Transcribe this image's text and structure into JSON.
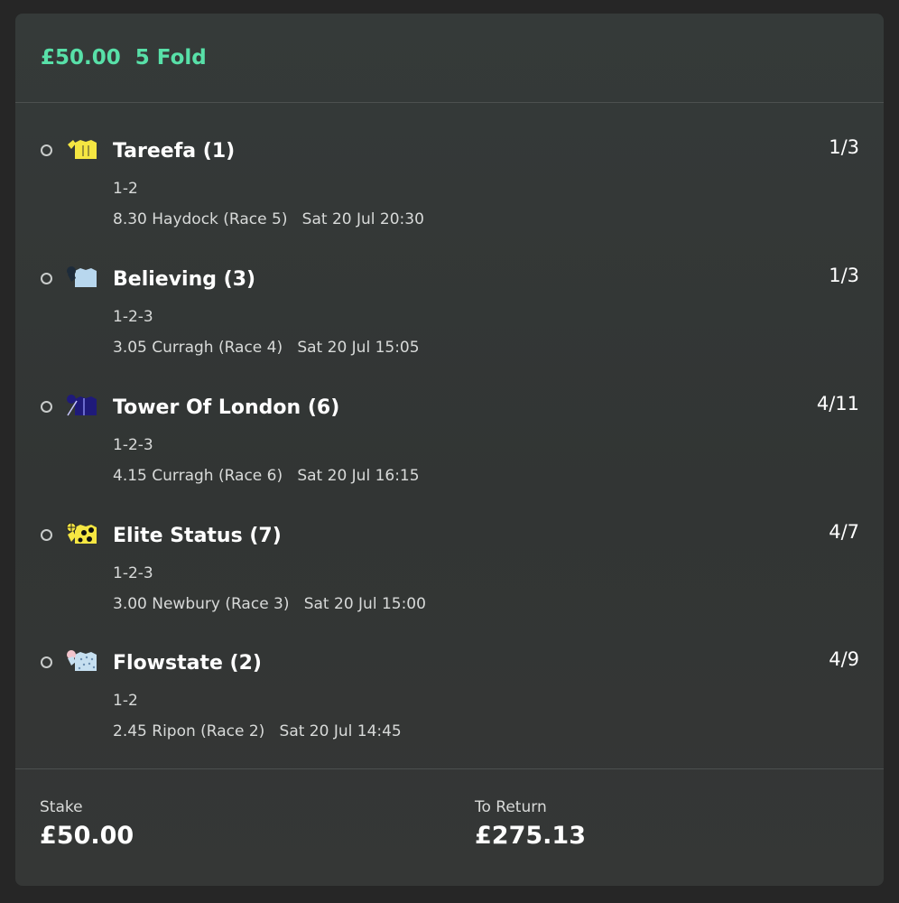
{
  "bet": {
    "stake_amount": "£50.00",
    "bet_type": "5 Fold"
  },
  "selections": [
    {
      "name": "Tareefa (1)",
      "odds": "1/3",
      "market": "1-2",
      "race": "8.30 Haydock (Race 5)",
      "datetime": "Sat 20 Jul 20:30",
      "silk_icon": "yellow-jockey-silk-icon"
    },
    {
      "name": "Believing (3)",
      "odds": "1/3",
      "market": "1-2-3",
      "race": "3.05 Curragh (Race 4)",
      "datetime": "Sat 20 Jul 15:05",
      "silk_icon": "light-blue-jockey-silk-icon"
    },
    {
      "name": "Tower Of London (6)",
      "odds": "4/11",
      "market": "1-2-3",
      "race": "4.15 Curragh (Race 6)",
      "datetime": "Sat 20 Jul 16:15",
      "silk_icon": "navy-jockey-silk-icon"
    },
    {
      "name": "Elite Status (7)",
      "odds": "4/7",
      "market": "1-2-3",
      "race": "3.00 Newbury (Race 3)",
      "datetime": "Sat 20 Jul 15:00",
      "silk_icon": "yellow-black-spots-jockey-silk-icon"
    },
    {
      "name": "Flowstate (2)",
      "odds": "4/9",
      "market": "1-2",
      "race": "2.45 Ripon (Race 2)",
      "datetime": "Sat 20 Jul 14:45",
      "silk_icon": "pale-blue-dotted-jockey-silk-icon"
    }
  ],
  "footer": {
    "stake_label": "Stake",
    "stake_value": "£50.00",
    "return_label": "To Return",
    "return_value": "£275.13"
  },
  "colors": {
    "accent": "#58e0a8",
    "card_background": "#353a39",
    "page_background": "#262626"
  }
}
